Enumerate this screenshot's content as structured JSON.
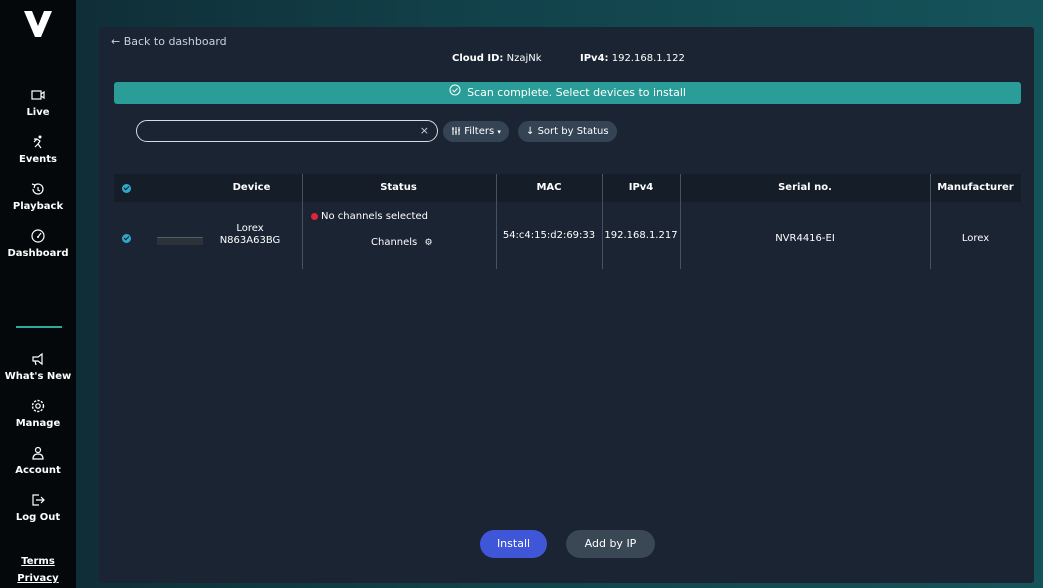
{
  "sidebar": {
    "logo": "V",
    "items": [
      {
        "label": "Live",
        "icon": "live-icon"
      },
      {
        "label": "Events",
        "icon": "events-icon"
      },
      {
        "label": "Playback",
        "icon": "playback-icon"
      },
      {
        "label": "Dashboard",
        "icon": "dashboard-icon"
      },
      {
        "label": "What's New",
        "icon": "megaphone-icon"
      },
      {
        "label": "Manage",
        "icon": "gear-icon"
      },
      {
        "label": "Account",
        "icon": "account-icon"
      },
      {
        "label": "Log Out",
        "icon": "logout-icon"
      }
    ],
    "footer": {
      "terms": "Terms",
      "privacy": "Privacy"
    }
  },
  "header": {
    "back_label": "← Back to dashboard",
    "cloud_id_label": "Cloud ID:",
    "cloud_id_value": "NzajNk",
    "ipv4_label": "IPv4:",
    "ipv4_value": "192.168.1.122"
  },
  "banner": {
    "text": "Scan complete. Select devices to install",
    "color": "#2a9d99"
  },
  "toolbar": {
    "search_placeholder": "",
    "search_value": "",
    "clear_label": "×",
    "filters_label": "Filters",
    "sort_label": "Sort by Status"
  },
  "table": {
    "columns": [
      "Device",
      "Status",
      "MAC",
      "IPv4",
      "Serial no.",
      "Manufacturer"
    ],
    "rows": [
      {
        "device_brand": "Lorex",
        "device_id": "N863A63BG",
        "status": "No channels selected",
        "status_color": "#e0243c",
        "channels_label": "Channels",
        "mac": "54:c4:15:d2:69:33",
        "ipv4": "192.168.1.217",
        "serial": "NVR4416-EI",
        "manufacturer": "Lorex"
      }
    ]
  },
  "actions": {
    "install_label": "Install",
    "add_by_ip_label": "Add by IP",
    "install_color": "#3f56d8"
  }
}
